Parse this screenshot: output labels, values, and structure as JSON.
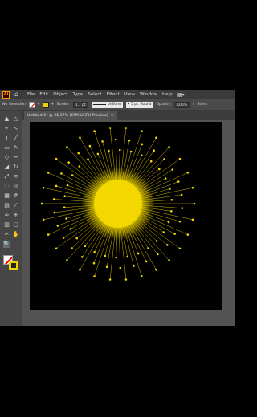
{
  "menubar": {
    "app_logo": "Ai",
    "items": [
      "File",
      "Edit",
      "Object",
      "Type",
      "Select",
      "Effect",
      "View",
      "Window",
      "Help"
    ]
  },
  "controlbar": {
    "selection_label": "No Selection",
    "stroke_label": "Stroke:",
    "stroke_weight": "1.7 pt",
    "brush_label": "Uniform",
    "profile_label": "5 pt. Round",
    "opacity_label": "Opacity:",
    "opacity_value": "100%",
    "style_label": "Style:"
  },
  "document": {
    "tab_title": "Untitled-1* @ 26.37% (CMYK/GPU Preview)",
    "close_icon": "×"
  },
  "colors": {
    "burst_color": "#f2d800",
    "canvas_bg": "#000000",
    "ui_bg": "#535353",
    "stroke_color": "#efd400"
  },
  "tools": [
    "selection-tool",
    "direct-selection-tool",
    "pen-tool",
    "curvature-tool",
    "type-tool",
    "line-tool",
    "rectangle-tool",
    "paintbrush-tool",
    "shaper-tool",
    "pencil-tool",
    "eraser-tool",
    "rotate-tool",
    "scale-tool",
    "width-tool",
    "free-transform-tool",
    "shape-builder-tool",
    "perspective-grid-tool",
    "mesh-tool",
    "gradient-tool",
    "eyedropper-tool",
    "blend-tool",
    "symbol-sprayer-tool",
    "column-graph-tool",
    "artboard-tool",
    "slice-tool",
    "hand-tool",
    "zoom-tool"
  ]
}
